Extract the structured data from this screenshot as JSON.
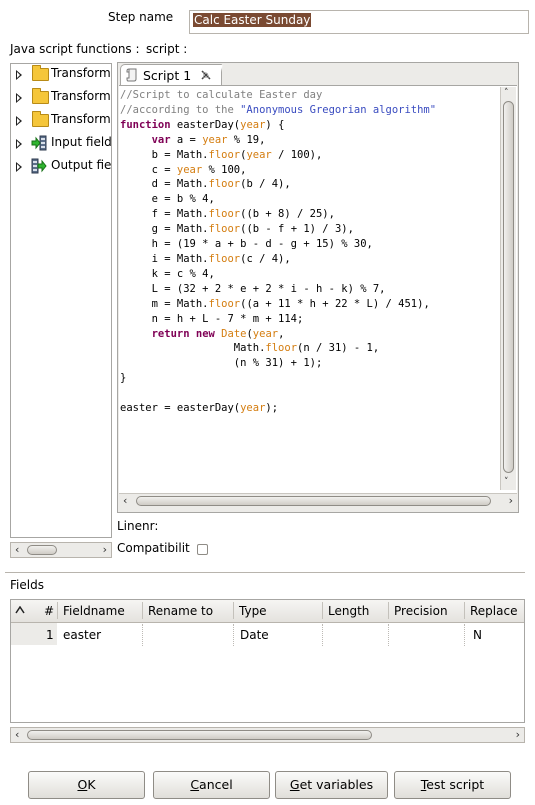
{
  "step_name": {
    "label": "Step name",
    "value": "Calc Easter Sunday"
  },
  "functions_label": "Java script functions :",
  "script_label": "script :",
  "tree": {
    "items": [
      {
        "label": "Transform",
        "icon": "folder-icon"
      },
      {
        "label": "Transform",
        "icon": "folder-icon"
      },
      {
        "label": "Transform",
        "icon": "folder-icon"
      },
      {
        "label": "Input field",
        "icon": "input-fields-icon"
      },
      {
        "label": "Output fie",
        "icon": "output-fields-icon"
      }
    ]
  },
  "editor": {
    "tab_label": "Script 1",
    "code_lines": [
      "//Script to calculate Easter day",
      "//according to the \"Anonymous Gregorian algorithm\"",
      "function easterDay(year) {",
      "     var a = year % 19,",
      "     b = Math.floor(year / 100),",
      "     c = year % 100,",
      "     d = Math.floor(b / 4),",
      "     e = b % 4,",
      "     f = Math.floor((b + 8) / 25),",
      "     g = Math.floor((b - f + 1) / 3),",
      "     h = (19 * a + b - d - g + 15) % 30,",
      "     i = Math.floor(c / 4),",
      "     k = c % 4,",
      "     L = (32 + 2 * e + 2 * i - h - k) % 7,",
      "     m = Math.floor((a + 11 * h + 22 * L) / 451),",
      "     n = h + L - 7 * m + 114;",
      "     return new Date(year,",
      "                  Math.floor(n / 31) - 1,",
      "                  (n % 31) + 1);",
      "}",
      "",
      "easter = easterDay(year);"
    ]
  },
  "linenr_label": "Linenr:",
  "compat_label": "Compatibilit",
  "compat_checked": false,
  "fields": {
    "label": "Fields",
    "columns": [
      "#",
      "Fieldname",
      "Rename to",
      "Type",
      "Length",
      "Precision",
      "Replace"
    ],
    "rows": [
      {
        "num": "1",
        "fieldname": "easter",
        "rename": "",
        "type": "Date",
        "length": "",
        "precision": "",
        "replace": "N"
      }
    ]
  },
  "buttons": {
    "ok": {
      "mnemonic": "O",
      "rest": "K"
    },
    "cancel": {
      "mnemonic": "C",
      "rest": "ancel"
    },
    "get_variables": {
      "mnemonic": "G",
      "rest": "et variables"
    },
    "test_script": {
      "mnemonic": "T",
      "rest": "est script"
    }
  },
  "colors": {
    "comment": "#808080",
    "keyword": "#7f0055",
    "variable": "#d47d10",
    "string": "#3a4cc0",
    "selection": "#7a4a32"
  }
}
